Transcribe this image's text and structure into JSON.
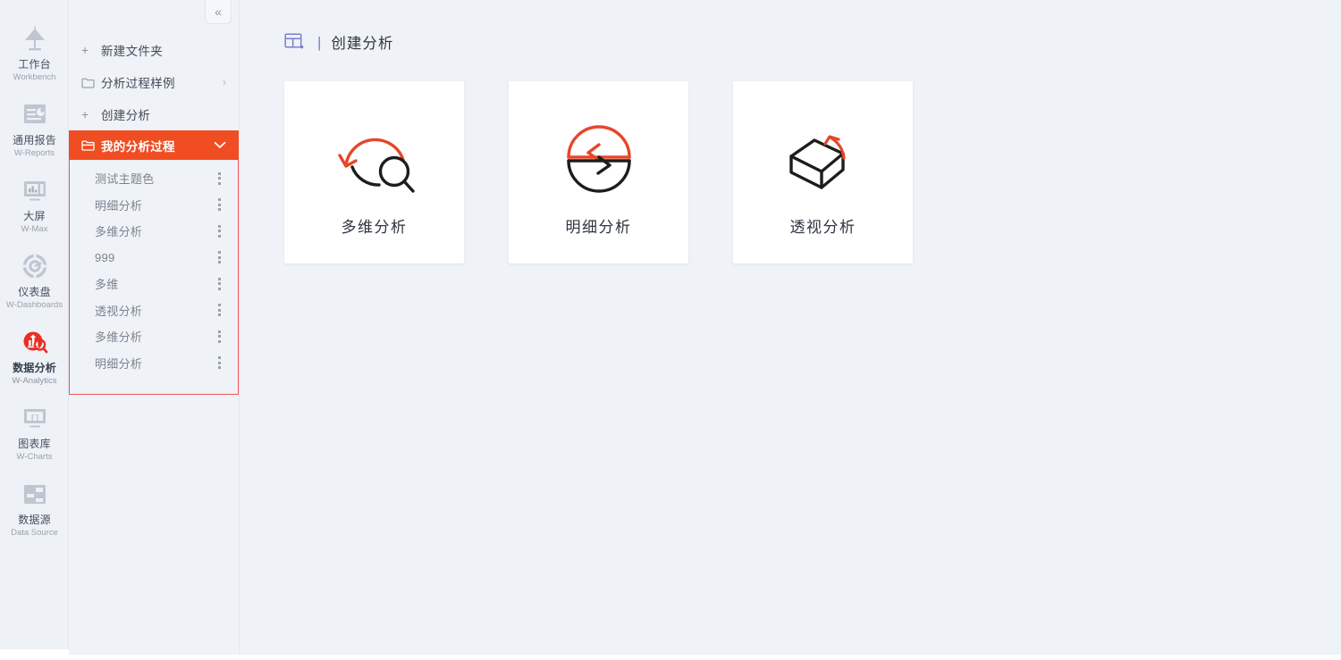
{
  "rail": {
    "items": [
      {
        "id": "workbench",
        "icon": "lamp-icon",
        "cn": "工作台",
        "en": "Workbench",
        "active": false
      },
      {
        "id": "reports",
        "icon": "report-icon",
        "cn": "通用报告",
        "en": "W-Reports",
        "active": false
      },
      {
        "id": "max",
        "icon": "bigscreen-icon",
        "cn": "大屏",
        "en": "W-Max",
        "active": false
      },
      {
        "id": "dashboards",
        "icon": "gauge-icon",
        "cn": "仪表盘",
        "en": "W-Dashboards",
        "active": false
      },
      {
        "id": "analytics",
        "icon": "analytics-icon",
        "cn": "数据分析",
        "en": "W-Analytics",
        "active": true
      },
      {
        "id": "charts",
        "icon": "charts-icon",
        "cn": "图表库",
        "en": "W-Charts",
        "active": false
      },
      {
        "id": "datasource",
        "icon": "database-icon",
        "cn": "数据源",
        "en": "Data Source",
        "active": false
      }
    ]
  },
  "panel": {
    "collapse_label": "«",
    "tree": [
      {
        "id": "new-folder",
        "lead": "+",
        "lead_icon": "plus-icon",
        "label": "新建文件夹",
        "tail": "",
        "tail_icon": "",
        "active": false
      },
      {
        "id": "sample-process",
        "lead": "folder",
        "lead_icon": "folder-icon",
        "label": "分析过程样例",
        "tail": "›",
        "tail_icon": "chevron-right-icon",
        "active": false
      },
      {
        "id": "create-analysis",
        "lead": "+",
        "lead_icon": "plus-icon",
        "label": "创建分析",
        "tail": "",
        "tail_icon": "",
        "active": false
      },
      {
        "id": "my-process",
        "lead": "folder-open",
        "lead_icon": "folder-icon",
        "label": "我的分析过程",
        "tail": "⌄",
        "tail_icon": "chevron-down-icon",
        "active": true
      }
    ],
    "sub_items": [
      {
        "id": "item-1",
        "label": "测试主题色"
      },
      {
        "id": "item-2",
        "label": "明细分析"
      },
      {
        "id": "item-3",
        "label": "多维分析"
      },
      {
        "id": "item-4",
        "label": "999"
      },
      {
        "id": "item-5",
        "label": "多维"
      },
      {
        "id": "item-6",
        "label": "透视分析"
      },
      {
        "id": "item-7",
        "label": "多维分析"
      },
      {
        "id": "item-8",
        "label": "明细分析"
      }
    ],
    "sub_menu_icon": "more-vertical-icon",
    "highlight_border_color": "#f2555a"
  },
  "header": {
    "icon": "layout-analysis-icon",
    "separator": "|",
    "title": "创建分析"
  },
  "cards": [
    {
      "id": "multidim",
      "icon": "circle-arrow-search-icon",
      "label": "多维分析"
    },
    {
      "id": "detail",
      "icon": "split-circle-arrows-icon",
      "label": "明细分析"
    },
    {
      "id": "pivot",
      "icon": "rotating-cube-icon",
      "label": "透视分析"
    }
  ],
  "colors": {
    "accent_orange": "#f04d23",
    "accent_red": "#e8462a",
    "icon_dark": "#1d1d1d",
    "bg": "#eff2f7",
    "card_bg": "#ffffff",
    "muted_text": "#7c838f",
    "header_icon": "#7b7fd0"
  }
}
